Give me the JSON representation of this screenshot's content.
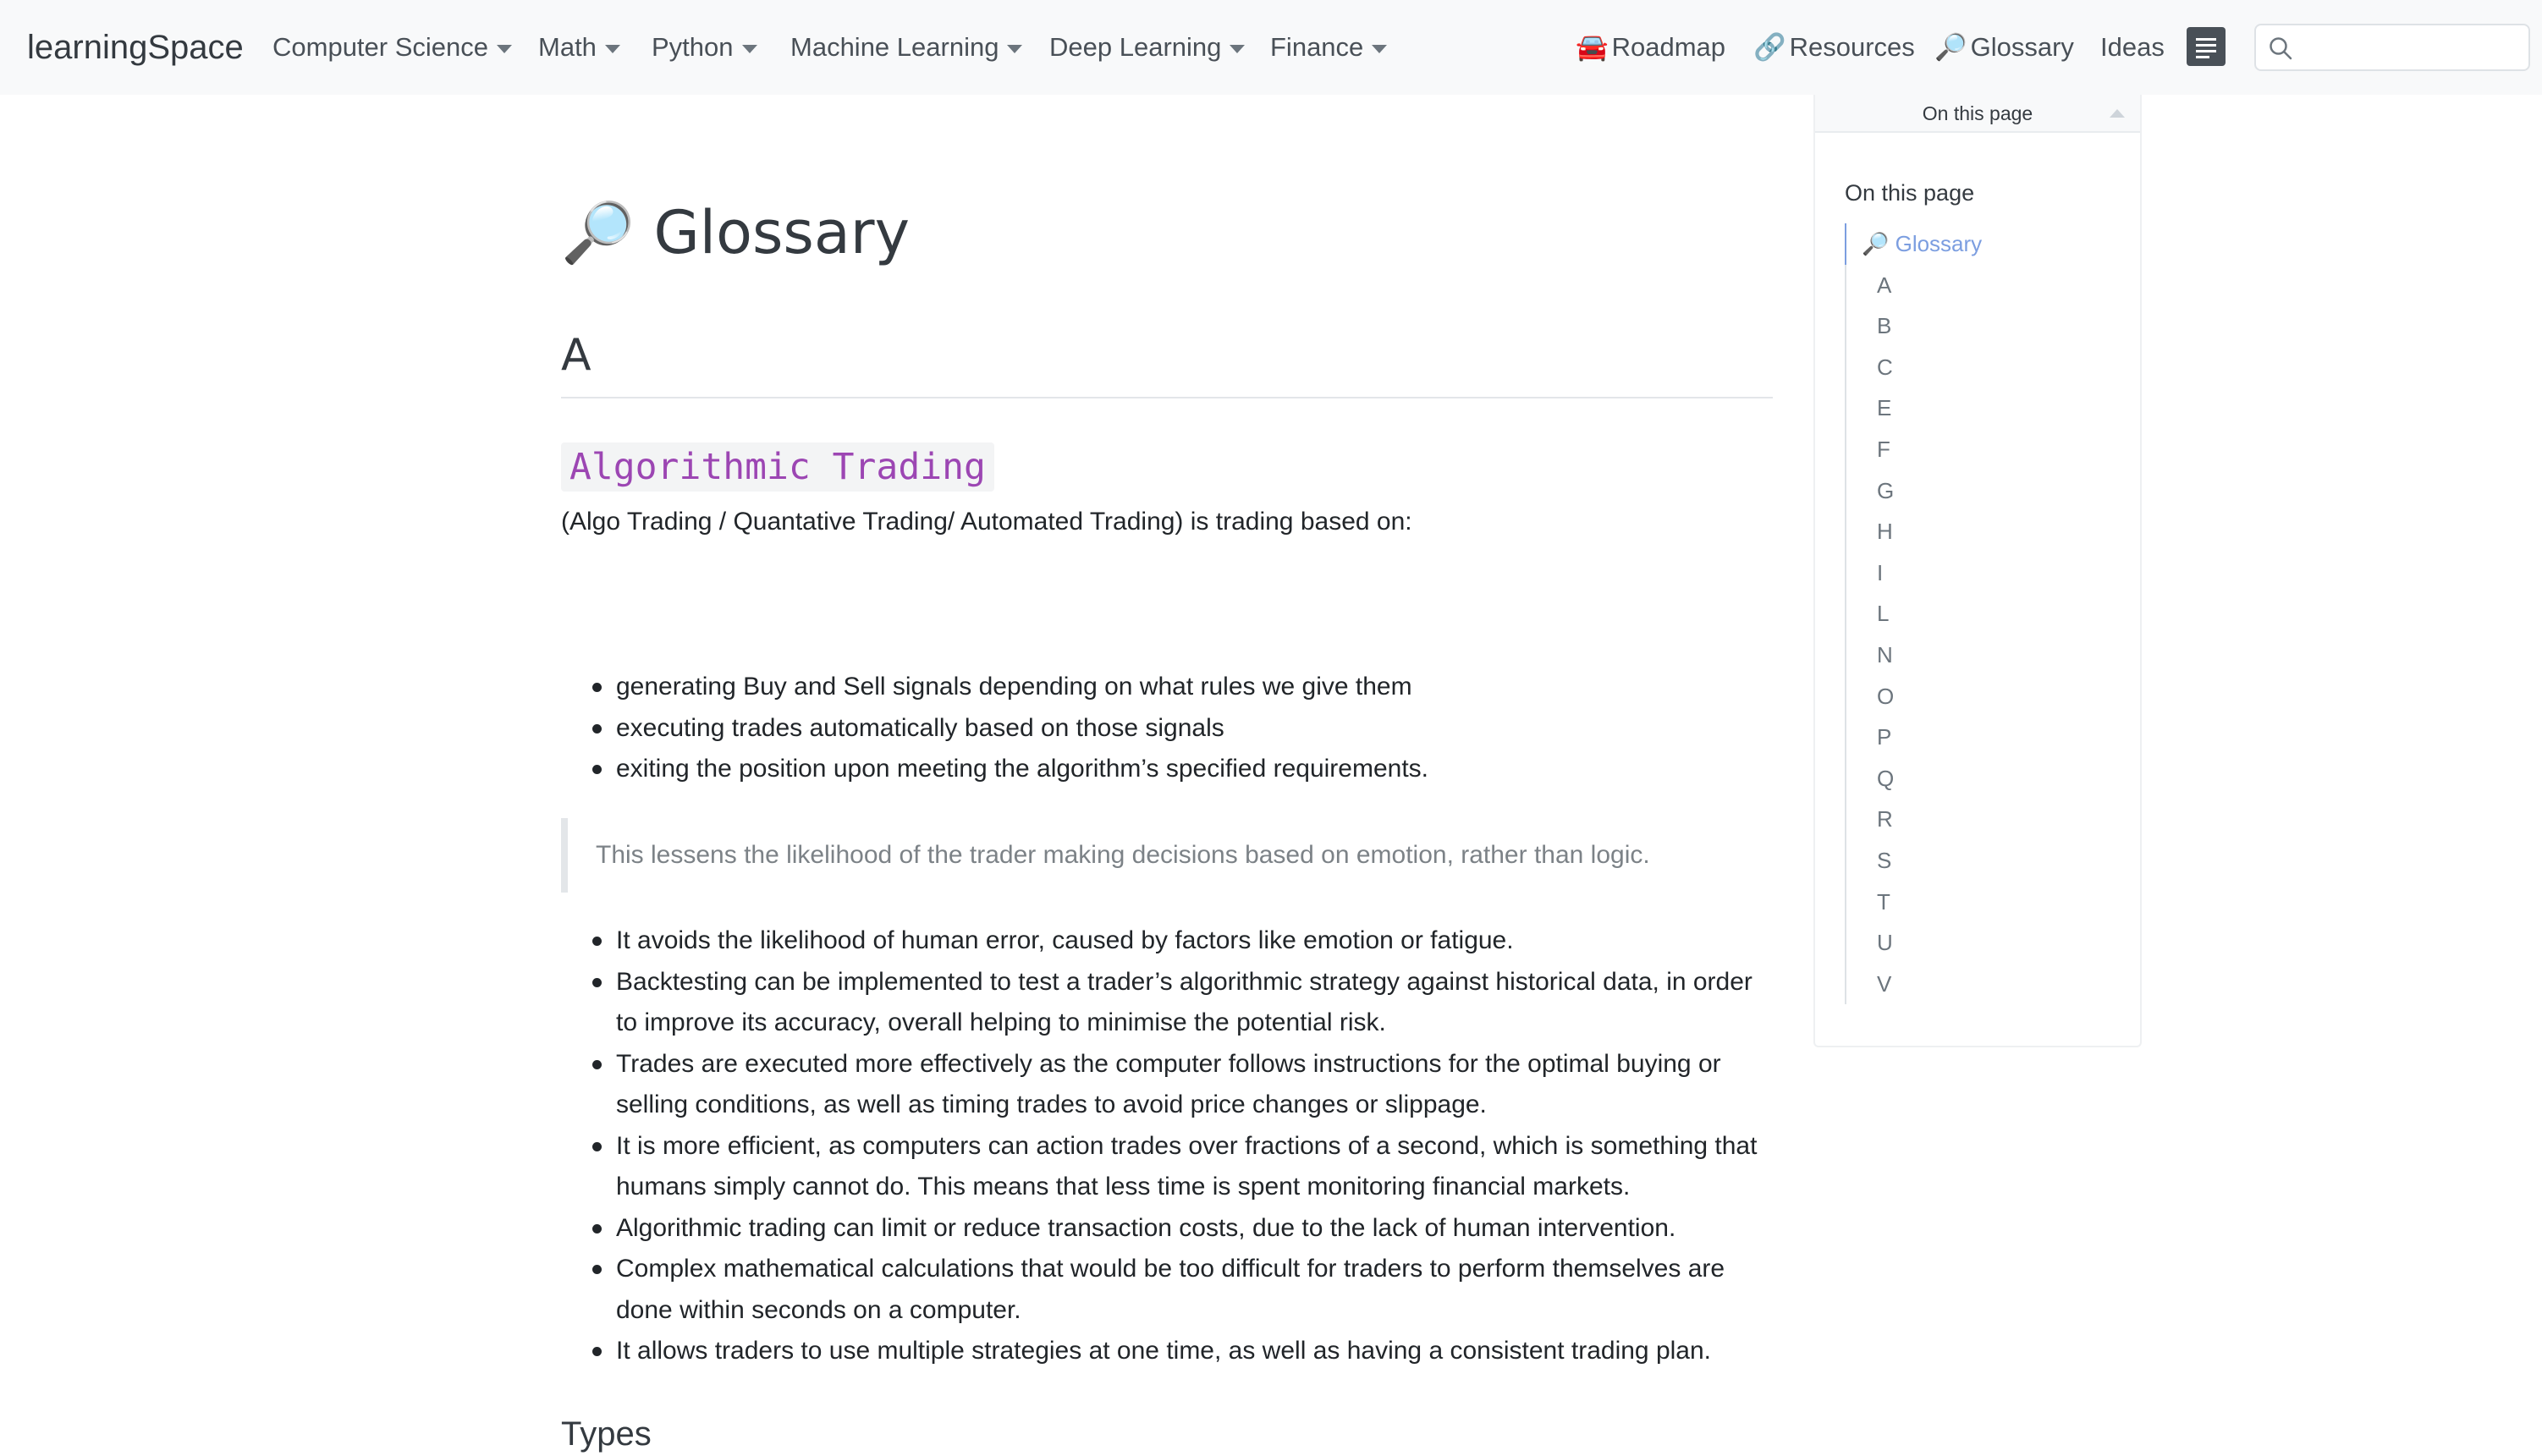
{
  "navbar": {
    "brand": "learningSpace",
    "menus": [
      {
        "label": "Computer Science"
      },
      {
        "label": "Math"
      },
      {
        "label": "Python"
      },
      {
        "label": "Machine Learning"
      },
      {
        "label": "Deep Learning"
      },
      {
        "label": "Finance"
      }
    ],
    "links": [
      {
        "label": "Roadmap",
        "icon": "🚘"
      },
      {
        "label": "Resources",
        "icon": "🔗"
      },
      {
        "label": "Glossary",
        "icon": "🔎"
      },
      {
        "label": "Ideas"
      }
    ],
    "search": {
      "placeholder": ""
    }
  },
  "page": {
    "title_icon": "🔎",
    "title": "Glossary",
    "section": "A",
    "term": "Algorithmic Trading",
    "intro": "(Algo Trading / Quantative Trading/ Automated Trading) is trading based on:",
    "list1": [
      "generating Buy and Sell signals depending on what rules we give them",
      "executing trades automatically based on those signals",
      "exiting the position upon meeting the algorithm’s specified requirements."
    ],
    "quote": "This lessens the likelihood of the trader making decisions based on emotion, rather than logic.",
    "list2": [
      "It avoids the likelihood of human error, caused by factors like emotion or fatigue.",
      "Backtesting can be implemented to test a trader’s algorithmic strategy against historical data, in order to improve its accuracy, overall helping to minimise the potential risk.",
      "Trades are executed more effectively as the computer follows instructions for the optimal buying or selling conditions, as well as timing trades to avoid price changes or slippage.",
      "It is more efficient, as computers can action trades over fractions of a second, which is something that humans simply cannot do. This means that less time is spent monitoring financial markets.",
      "Algorithmic trading can limit or reduce transaction costs, due to the lack of human intervention.",
      "Complex mathematical calculations that would be too difficult for traders to perform themselves are done within seconds on a computer.",
      "It allows traders to use multiple strategies at one time, as well as having a consistent trading plan."
    ],
    "subheading": "Types"
  },
  "toc": {
    "header": "On this page",
    "title": "On this page",
    "items": [
      {
        "label": "🔎 Glossary",
        "active": true
      },
      {
        "label": "A"
      },
      {
        "label": "B"
      },
      {
        "label": "C"
      },
      {
        "label": "E"
      },
      {
        "label": "F"
      },
      {
        "label": "G"
      },
      {
        "label": "H"
      },
      {
        "label": "I"
      },
      {
        "label": "L"
      },
      {
        "label": "N"
      },
      {
        "label": "O"
      },
      {
        "label": "P"
      },
      {
        "label": "Q"
      },
      {
        "label": "R"
      },
      {
        "label": "S"
      },
      {
        "label": "T"
      },
      {
        "label": "U"
      },
      {
        "label": "V"
      }
    ]
  },
  "colors": {
    "navbar_bg": "#f8f9fa",
    "term_text": "#9c46b3",
    "toc_active": "#7c9ee0",
    "quote_text": "#7c8287"
  }
}
